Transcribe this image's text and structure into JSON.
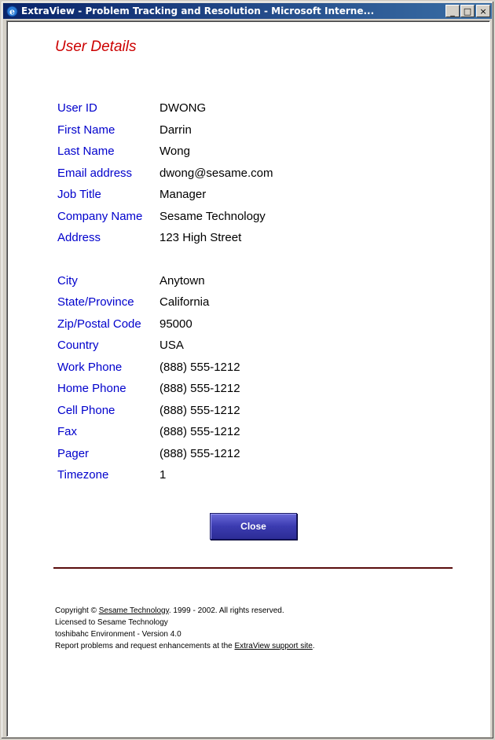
{
  "window": {
    "title": "ExtraView - Problem Tracking and Resolution - Microsoft Interne...",
    "buttons": {
      "minimize": "_",
      "maximize": "□",
      "close": "×"
    }
  },
  "page": {
    "title": "User Details"
  },
  "details": [
    {
      "label": "User ID",
      "value": "DWONG"
    },
    {
      "label": "First Name",
      "value": "Darrin"
    },
    {
      "label": "Last Name",
      "value": "Wong"
    },
    {
      "label": "Email address",
      "value": "dwong@sesame.com"
    },
    {
      "label": "Job Title",
      "value": "Manager"
    },
    {
      "label": "Company Name",
      "value": "Sesame Technology"
    },
    {
      "label": "Address",
      "value": "123 High Street"
    },
    {
      "label": "City",
      "value": "Anytown"
    },
    {
      "label": "State/Province",
      "value": "California"
    },
    {
      "label": "Zip/Postal Code",
      "value": "95000"
    },
    {
      "label": "Country",
      "value": "USA"
    },
    {
      "label": "Work Phone",
      "value": "(888) 555-1212"
    },
    {
      "label": "Home Phone",
      "value": "(888) 555-1212"
    },
    {
      "label": "Cell Phone",
      "value": "(888) 555-1212"
    },
    {
      "label": "Fax",
      "value": "(888) 555-1212"
    },
    {
      "label": "Pager",
      "value": "(888) 555-1212"
    },
    {
      "label": "Timezone",
      "value": "1"
    }
  ],
  "buttons": {
    "close_label": "Close"
  },
  "footer": {
    "copyright_prefix": "Copyright © ",
    "copyright_link": "Sesame Technology",
    "copyright_suffix": ". 1999 - 2002.  All rights reserved.",
    "licensed": "Licensed to Sesame Technology",
    "environment": "toshibahc Environment - Version 4.0",
    "report_prefix": "Report problems and request enhancements at the ",
    "report_link": "ExtraView support site",
    "report_suffix": "."
  },
  "colors": {
    "title_red": "#cc0000",
    "label_blue": "#0000cc",
    "button_blue": "#3b3bb0",
    "rule_maroon": "#5a0c0c",
    "titlebar_navy": "#0a246a"
  }
}
